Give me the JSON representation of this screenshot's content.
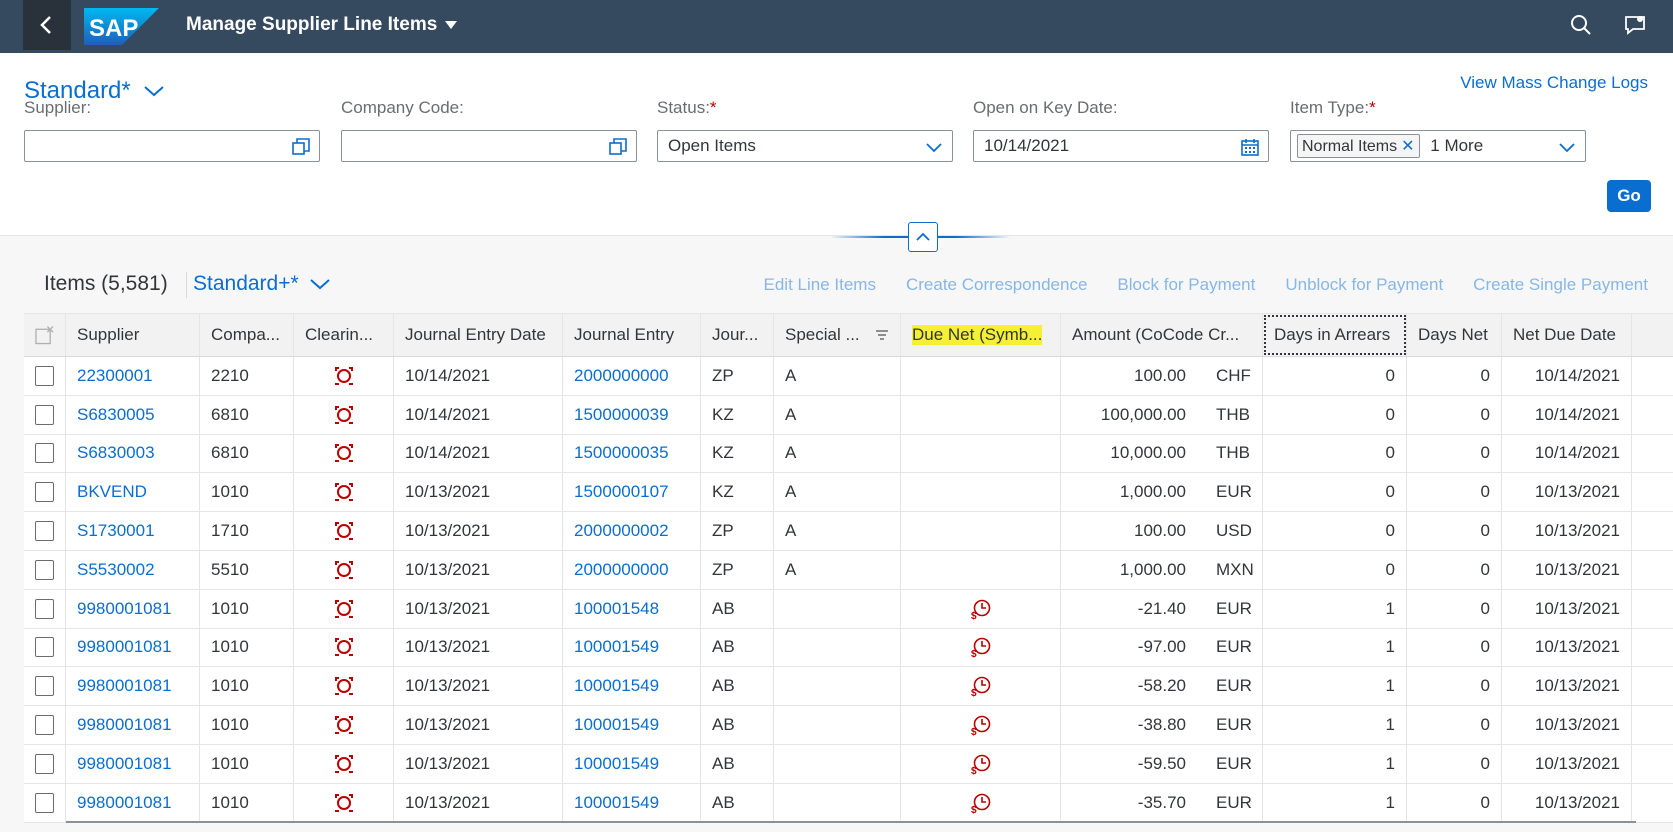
{
  "shell": {
    "app_title": "Manage Supplier Line Items"
  },
  "header": {
    "variant": "Standard*",
    "mass_change_link": "View Mass Change Logs",
    "filters": [
      {
        "label": "Supplier:",
        "required": false,
        "value": ""
      },
      {
        "label": "Company Code:",
        "required": false,
        "value": ""
      },
      {
        "label": "Status:",
        "required": true,
        "value": "Open Items"
      },
      {
        "label": "Open on Key Date:",
        "required": false,
        "value": "10/14/2021"
      },
      {
        "label": "Item Type:",
        "required": true,
        "token": "Normal Items",
        "more": "1 More"
      }
    ],
    "go_label": "Go"
  },
  "table_toolbar": {
    "title": "Items (5,581)",
    "variant": "Standard+*",
    "actions": [
      "Edit Line Items",
      "Create Correspondence",
      "Block for Payment",
      "Unblock for Payment",
      "Create Single Payment"
    ]
  },
  "columns": [
    "Supplier",
    "Compa...",
    "Clearin...",
    "Journal Entry Date",
    "Journal Entry",
    "Jour...",
    "Special ...",
    "Due Net (Symb...",
    "Amount (CoCode Cr...",
    "Days in Arrears",
    "Days Net",
    "Net Due Date"
  ],
  "rows": [
    {
      "supplier": "22300001",
      "company": "2210",
      "date": "10/14/2021",
      "je": "2000000000",
      "type": "ZP",
      "special": "A",
      "due_icon": false,
      "amount": "100.00",
      "currency": "CHF",
      "arrears": "0",
      "net": "0",
      "due_date": "10/14/2021"
    },
    {
      "supplier": "S6830005",
      "company": "6810",
      "date": "10/14/2021",
      "je": "1500000039",
      "type": "KZ",
      "special": "A",
      "due_icon": false,
      "amount": "100,000.00",
      "currency": "THB",
      "arrears": "0",
      "net": "0",
      "due_date": "10/14/2021"
    },
    {
      "supplier": "S6830003",
      "company": "6810",
      "date": "10/14/2021",
      "je": "1500000035",
      "type": "KZ",
      "special": "A",
      "due_icon": false,
      "amount": "10,000.00",
      "currency": "THB",
      "arrears": "0",
      "net": "0",
      "due_date": "10/14/2021"
    },
    {
      "supplier": "BKVEND",
      "company": "1010",
      "date": "10/13/2021",
      "je": "1500000107",
      "type": "KZ",
      "special": "A",
      "due_icon": false,
      "amount": "1,000.00",
      "currency": "EUR",
      "arrears": "0",
      "net": "0",
      "due_date": "10/13/2021"
    },
    {
      "supplier": "S1730001",
      "company": "1710",
      "date": "10/13/2021",
      "je": "2000000002",
      "type": "ZP",
      "special": "A",
      "due_icon": false,
      "amount": "100.00",
      "currency": "USD",
      "arrears": "0",
      "net": "0",
      "due_date": "10/13/2021"
    },
    {
      "supplier": "S5530002",
      "company": "5510",
      "date": "10/13/2021",
      "je": "2000000000",
      "type": "ZP",
      "special": "A",
      "due_icon": false,
      "amount": "1,000.00",
      "currency": "MXN",
      "arrears": "0",
      "net": "0",
      "due_date": "10/13/2021"
    },
    {
      "supplier": "9980001081",
      "company": "1010",
      "date": "10/13/2021",
      "je": "100001548",
      "type": "AB",
      "special": "",
      "due_icon": true,
      "amount": "-21.40",
      "currency": "EUR",
      "arrears": "1",
      "net": "0",
      "due_date": "10/13/2021"
    },
    {
      "supplier": "9980001081",
      "company": "1010",
      "date": "10/13/2021",
      "je": "100001549",
      "type": "AB",
      "special": "",
      "due_icon": true,
      "amount": "-97.00",
      "currency": "EUR",
      "arrears": "1",
      "net": "0",
      "due_date": "10/13/2021"
    },
    {
      "supplier": "9980001081",
      "company": "1010",
      "date": "10/13/2021",
      "je": "100001549",
      "type": "AB",
      "special": "",
      "due_icon": true,
      "amount": "-58.20",
      "currency": "EUR",
      "arrears": "1",
      "net": "0",
      "due_date": "10/13/2021"
    },
    {
      "supplier": "9980001081",
      "company": "1010",
      "date": "10/13/2021",
      "je": "100001549",
      "type": "AB",
      "special": "",
      "due_icon": true,
      "amount": "-38.80",
      "currency": "EUR",
      "arrears": "1",
      "net": "0",
      "due_date": "10/13/2021"
    },
    {
      "supplier": "9980001081",
      "company": "1010",
      "date": "10/13/2021",
      "je": "100001549",
      "type": "AB",
      "special": "",
      "due_icon": true,
      "amount": "-59.50",
      "currency": "EUR",
      "arrears": "1",
      "net": "0",
      "due_date": "10/13/2021"
    },
    {
      "supplier": "9980001081",
      "company": "1010",
      "date": "10/13/2021",
      "je": "100001549",
      "type": "AB",
      "special": "",
      "due_icon": true,
      "amount": "-35.70",
      "currency": "EUR",
      "arrears": "1",
      "net": "0",
      "due_date": "10/13/2021"
    }
  ],
  "colors": {
    "shell": "#354a5f",
    "link": "#0a6ed1",
    "clearing_icon": "#bb0000",
    "highlight": "#f5f035"
  }
}
